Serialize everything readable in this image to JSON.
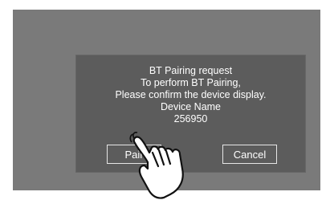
{
  "dialog": {
    "lines": [
      "BT Pairing request",
      "To perform BT Pairing,",
      "Please confirm the device display.",
      "Device Name",
      "256950"
    ],
    "pair_label": "Pair",
    "cancel_label": "Cancel"
  },
  "icons": {
    "pointer": "hand-pointer-icon"
  },
  "colors": {
    "screen_bg": "#7a7a7a",
    "dialog_bg": "#5c5c5c",
    "text": "#ffffff",
    "button_border": "#e6e6e6"
  }
}
